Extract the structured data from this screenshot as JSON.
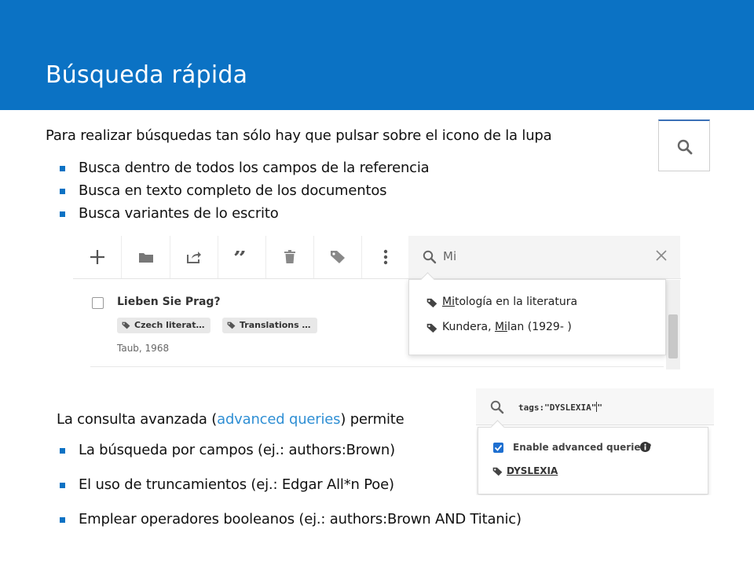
{
  "slide": {
    "title": "Búsqueda rápida",
    "intro": "Para realizar búsquedas tan sólo hay que pulsar sobre el icono de la lupa",
    "bullets_simple": [
      "Busca dentro de todos los campos de la referencia",
      "Busca en texto completo de los documentos",
      "Busca variantes de lo escrito"
    ],
    "advanced_prefix": "La consulta avanzada (",
    "advanced_link": "advanced queries",
    "advanced_suffix": ") permite",
    "bullets_advanced": [
      "La búsqueda por campos (ej.: authors:Brown)",
      "El uso de truncamientos (ej.: Edgar All*n Poe)",
      "Emplear operadores booleanos (ej.: authors:Brown AND Titanic)"
    ]
  },
  "screenshot1": {
    "search_value": "Mi",
    "item": {
      "title": "Lieben Sie Prag?",
      "tags": [
        "Czech literat…",
        "Translations …"
      ],
      "meta": "Taub, 1968"
    },
    "suggestions": [
      {
        "match": "Mi",
        "rest": "tología en la literatura"
      },
      {
        "before": "Kundera, ",
        "match": "Mi",
        "rest": "lan (1929- )"
      }
    ]
  },
  "screenshot2": {
    "query_text": "tags:\"DYSLEXIA\"",
    "query_after": "\"",
    "enable_label": "Enable advanced queries?",
    "tag_result": "DYSLEXIA"
  },
  "colors": {
    "header_blue": "#0b72c4",
    "link_blue": "#2f8fd4",
    "bullet_blue": "#0b72c4"
  },
  "icons": [
    "search-icon",
    "plus-icon",
    "folder-icon",
    "share-icon",
    "quote-icon",
    "trash-icon",
    "tag-icon",
    "more-icon",
    "close-icon",
    "info-icon",
    "check-icon"
  ]
}
